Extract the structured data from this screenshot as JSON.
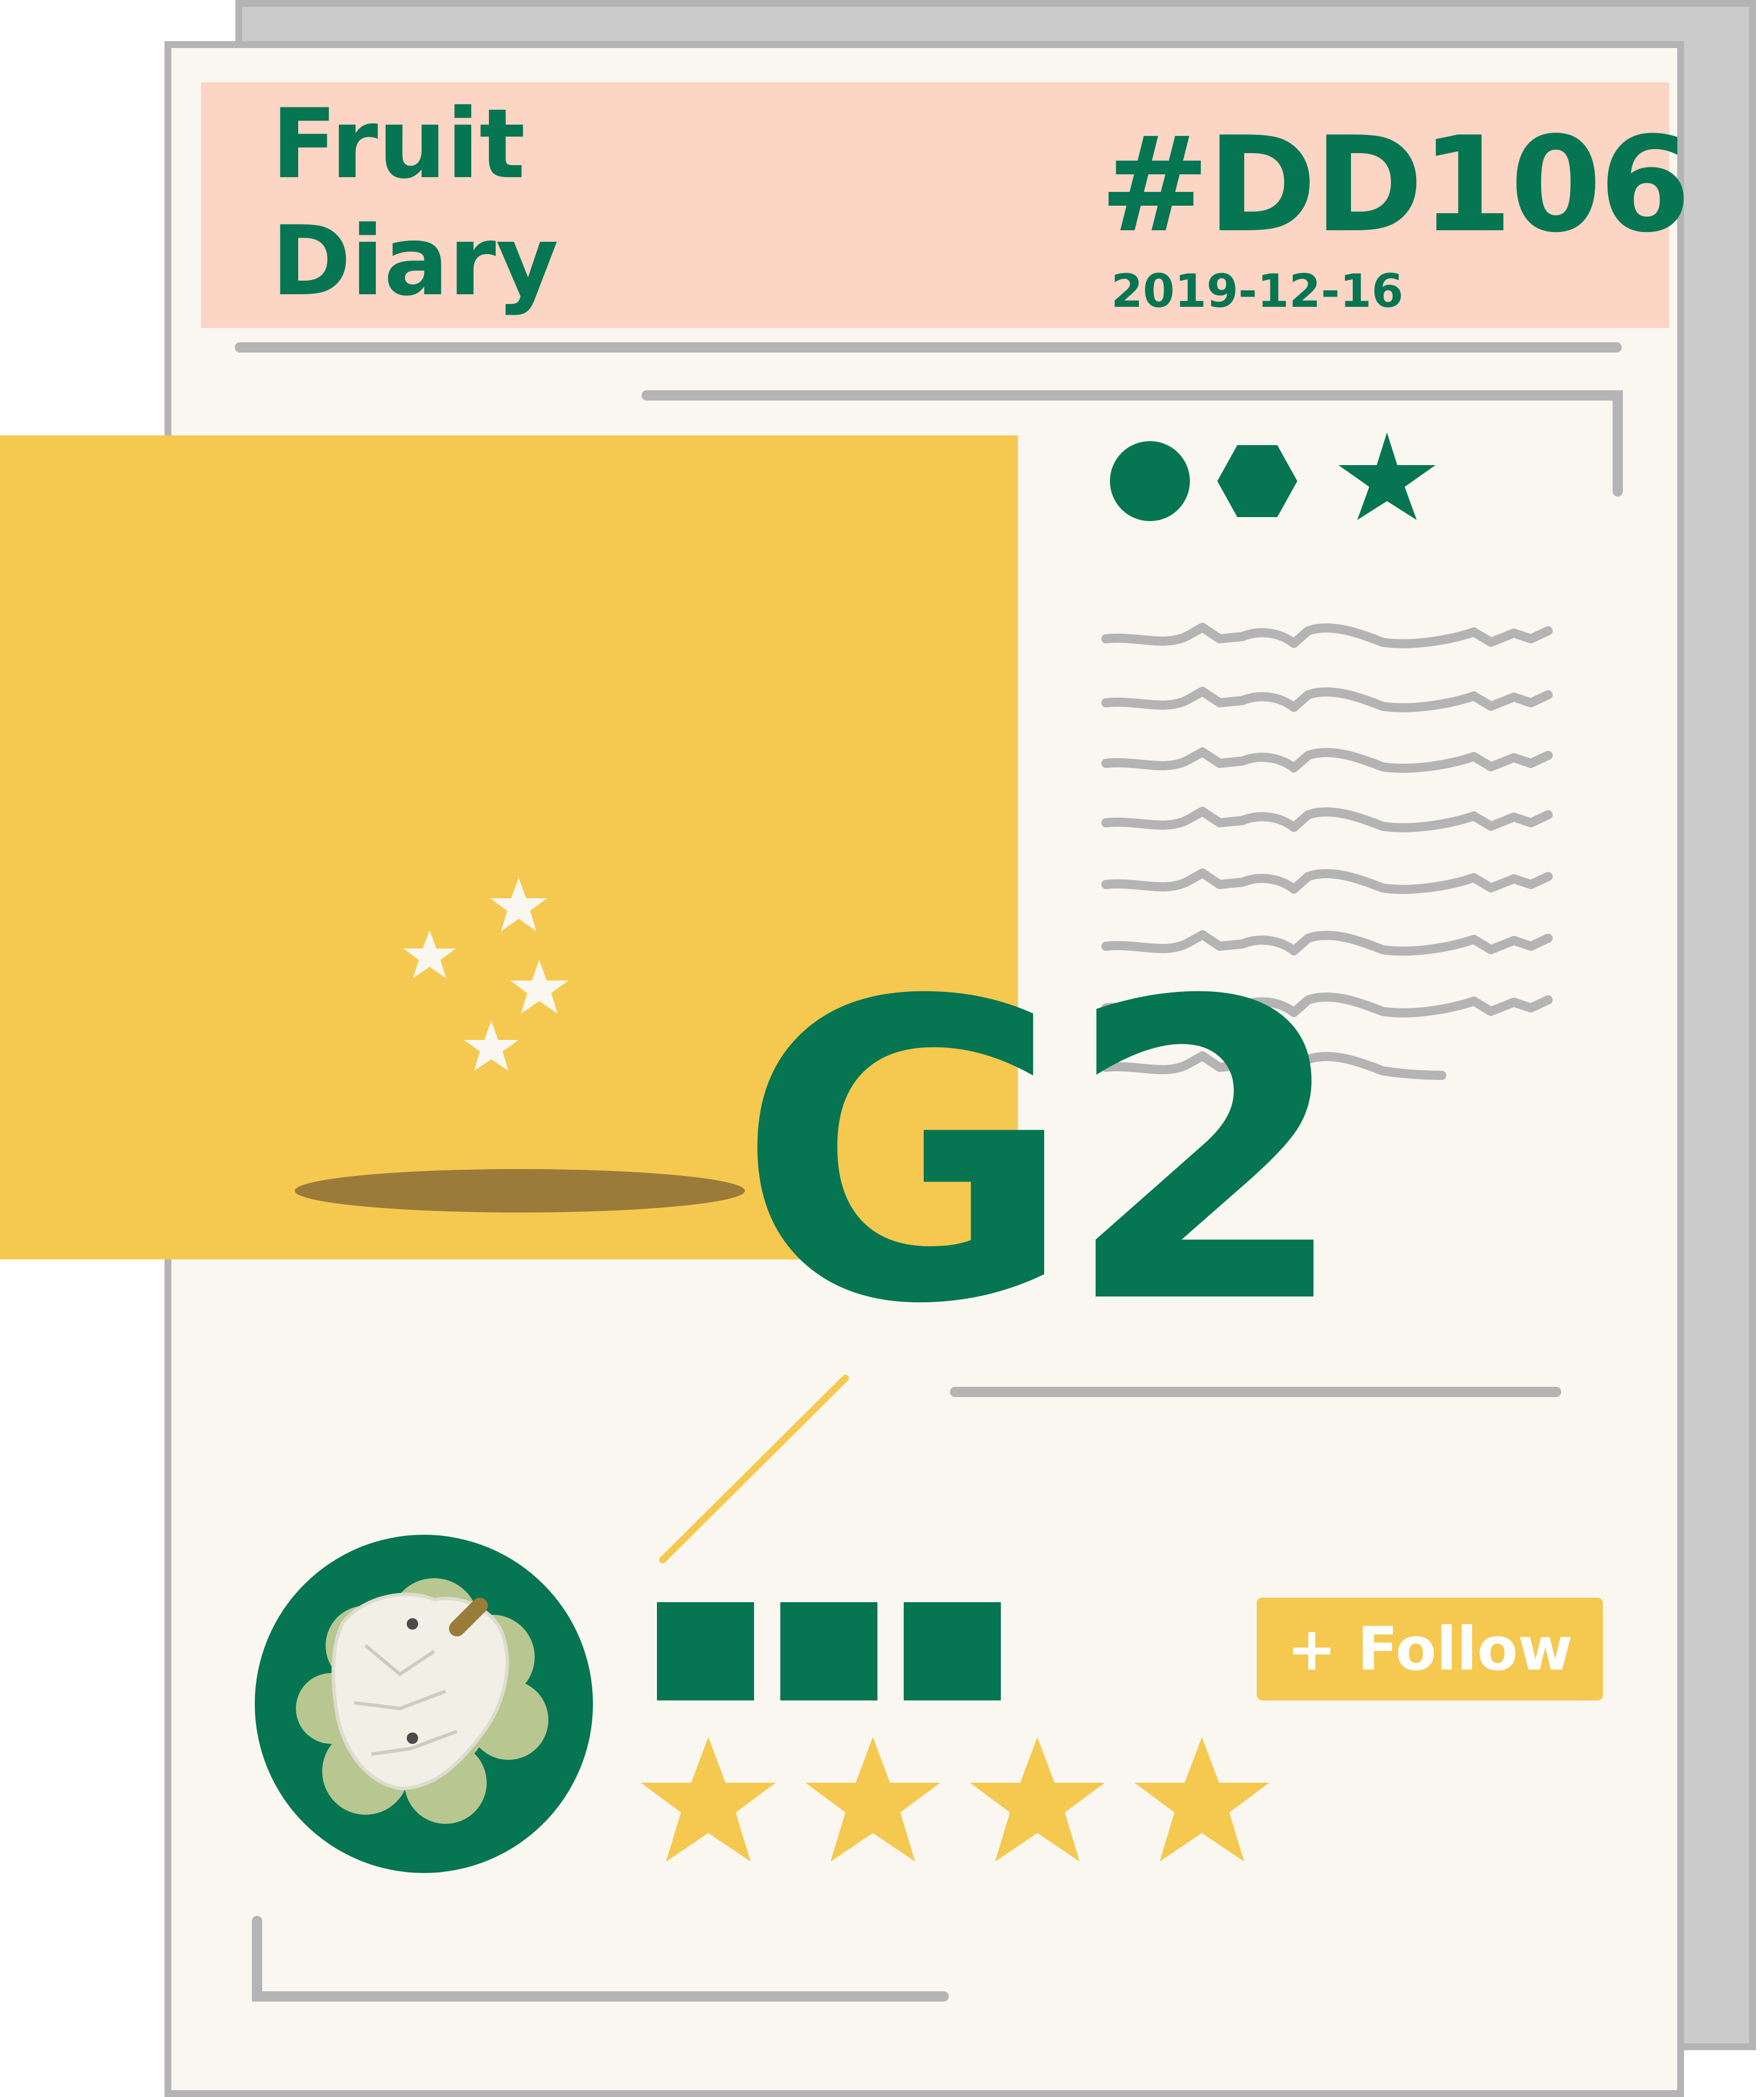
{
  "header": {
    "brand_title": "Fruit\nDiary",
    "issue_number": "#DD106",
    "date": "2019-12-16"
  },
  "grade": "G2",
  "follow_button": {
    "label": "+ Follow"
  },
  "rating": {
    "stars_filled": 4
  },
  "colors": {
    "green": "#057552",
    "yellow": "#f5c850",
    "pink": "#fcd5c4",
    "paper": "#f9f7f0",
    "gray": "#b4b4b4"
  },
  "icons": [
    "circle-icon",
    "hexagon-icon",
    "star-icon",
    "sparkle-stars-icon",
    "custard-apple-icon",
    "star-rating-icon"
  ]
}
